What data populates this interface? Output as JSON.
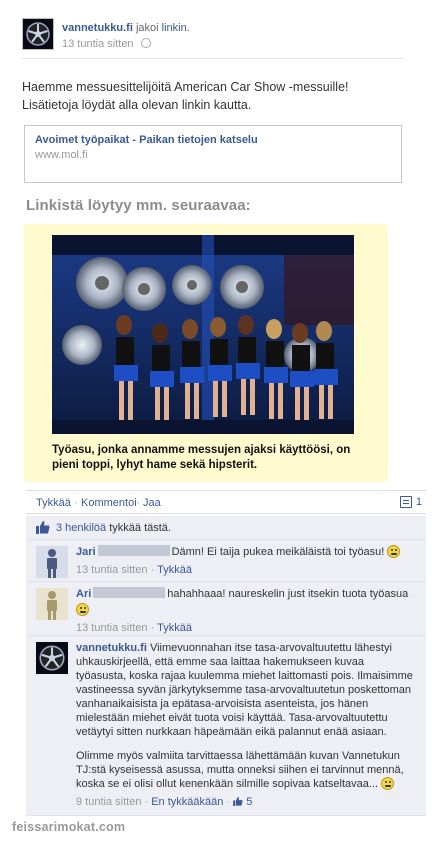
{
  "post": {
    "author": "vannetukku.fi",
    "shared_text": "jakoi",
    "shared_link_text": "linkin.",
    "timestamp": "13 tuntia sitten",
    "message_line1": "Haemme messuesittelijöitä American Car Show -messuille!",
    "message_line2": "Lisätietoja löydät alla olevan linkin kautta."
  },
  "link_preview": {
    "title": "Avoimet työpaikat - Paikan tietojen katselu",
    "domain": "www.mol.fi"
  },
  "section_heading": "Linkistä löytyy mm. seuraavaa:",
  "photo_caption": "Työasu, jonka annamme messujen ajaksi käyttöösi, on pieni toppi, lyhyt hame sekä hipsterit.",
  "actions": {
    "like": "Tykkää",
    "comment": "Kommentoi",
    "share": "Jaa",
    "comment_count": "1"
  },
  "likes": {
    "people": "3 henkilöä",
    "rest": "tykkää tästä."
  },
  "comments": [
    {
      "name": "Jari",
      "text": "Dämn! Ei taija pukea meikäläistä toi työasu!",
      "time": "13 tuntia sitten",
      "like": "Tykkää"
    },
    {
      "name": "Ari",
      "text": "hahahhaaa! naureskelin just itsekin tuota työasua",
      "time": "13 tuntia sitten",
      "like": "Tykkää"
    },
    {
      "name": "vannetukku.fi",
      "text": "Viimevuonnahan itse tasa-arvovaltuutettu lähestyi uhkauskirjeellä, että emme saa laittaa hakemukseen kuvaa työasusta, koska rajaa kuulemma miehet laittomasti pois. Ilmaisimme vastineessa syvän järkytyksemme tasa-arvovaltuutetun poskettoman vanhanaikaisista ja epätasa-arvoisista asenteista, jos hänen mielestään miehet eivät tuota voisi käyttää. Tasa-arvovaltuutettu vetäytyi sitten nurkkaan häpeämään eikä palannut enää asiaan.",
      "text2": "Olimme myös valmiita tarvittaessa lähettämään kuvan Vannetukun TJ:stä kyseisessä asussa, mutta onneksi siihen ei tarvinnut mennä, koska se ei olisi ollut kenenkään silmille sopivaa katseltavaa...",
      "time": "9 tuntia sitten",
      "unlike": "En tykkääkään",
      "like_count": "5"
    }
  ],
  "watermark": "feissarimokat.com",
  "colors": {
    "facebook_blue": "#3b5998",
    "comment_bg": "#edeff4",
    "photo_box_bg": "#fffbcf"
  }
}
